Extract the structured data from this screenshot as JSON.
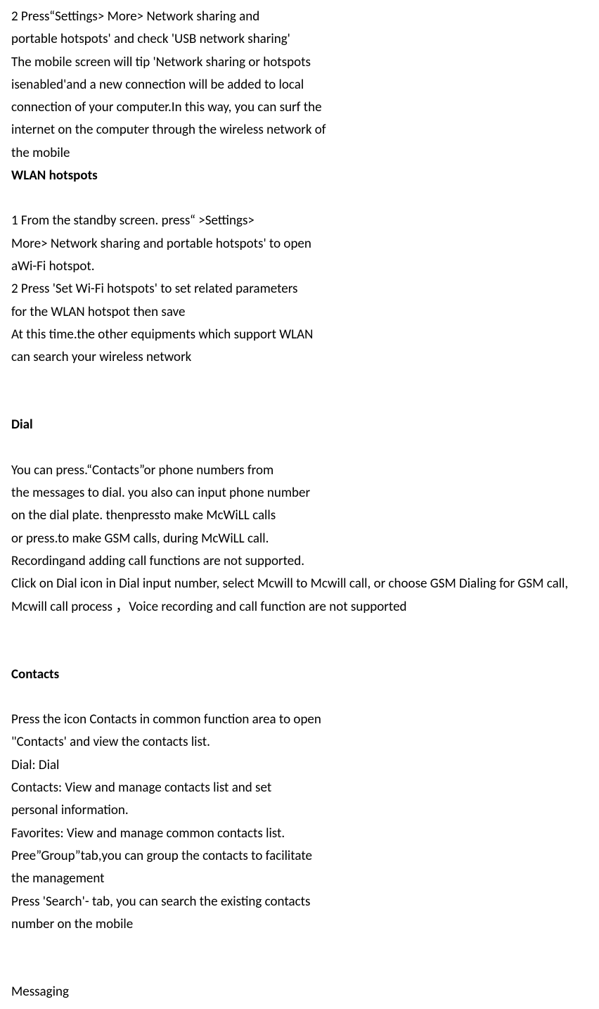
{
  "lines": {
    "l1": "2 Press“Settings> More> Network sharing and",
    "l2": "portable hotspots' and check 'USB network sharing'",
    "l3": "The mobile screen will tip 'Network sharing or hotspots",
    "l4": "isenabled'and a new connection will be added to local",
    "l5": "connection of your computer.In this way, you can surf the",
    "l6": "internet on the computer through the wireless network of",
    "l7": "the mobile",
    "h1": "WLAN hotspots",
    "l8": "1 From the standby screen. press“ >Settings>",
    "l9": "More> Network sharing and portable hotspots' to open",
    "l10": "aWi-Fi hotspot.",
    "l11": "2 Press 'Set Wi-Fi hotspots' to set related parameters",
    "l12": "for the WLAN hotspot then save",
    "l13": "At this time.the other equipments which support WLAN",
    "l14": "can search your wireless network",
    "h2": "Dial",
    "l15": "You can press.“Contacts”or phone numbers from",
    "l16": "the messages to dial. you also can input phone number",
    "l17": "on the dial plate. thenpressto make McWiLL calls",
    "l18": "or press.to make GSM calls, during McWiLL call.",
    "l19": "Recordingand adding call functions are not supported.",
    "l20": "Click on Dial icon in Dial input number, select Mcwill to Mcwill call, or choose GSM Dialing for GSM call, Mcwill call process ，Voice recording and call function are not supported",
    "h3": "Contacts",
    "l21": "Press the icon Contacts in common function area to open",
    "l22": "\"Contacts' and view the contacts list.",
    "l23": "Dial: Dial",
    "l24": "Contacts: View and manage contacts list and set",
    "l25": "personal information.",
    "l26": "Favorites: View and manage common contacts list.",
    "l27": "Pree”Group”tab,you can group the contacts to facilitate",
    "l28": "the management",
    "l29": "Press 'Search'- tab, you can search the existing contacts",
    "l30": "number on the mobile",
    "h4": "Messaging"
  }
}
